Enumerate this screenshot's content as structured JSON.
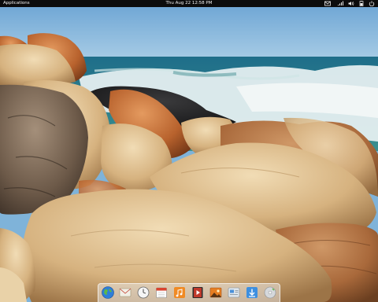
{
  "panel": {
    "applications_label": "Applications",
    "clock": "Thu Aug 22 12:58 PM",
    "indicators": [
      "mail-icon",
      "network-icon",
      "volume-icon",
      "battery-icon",
      "power-icon"
    ]
  },
  "dock": {
    "items": [
      "web-browser-icon",
      "mail-client-icon",
      "clock-app-icon",
      "calendar-icon",
      "music-player-icon",
      "video-player-icon",
      "photos-icon",
      "system-settings-icon",
      "software-center-icon",
      "disk-utility-icon"
    ]
  },
  "colors": {
    "panel_bg": "#0c0c0c",
    "sky": "#7fb3d9",
    "sea": "#2f7f8a",
    "foam": "#e8f2f4",
    "rock_light": "#dcbf8e",
    "rock_orange": "#c4713a",
    "rock_dark": "#1e1e20"
  }
}
